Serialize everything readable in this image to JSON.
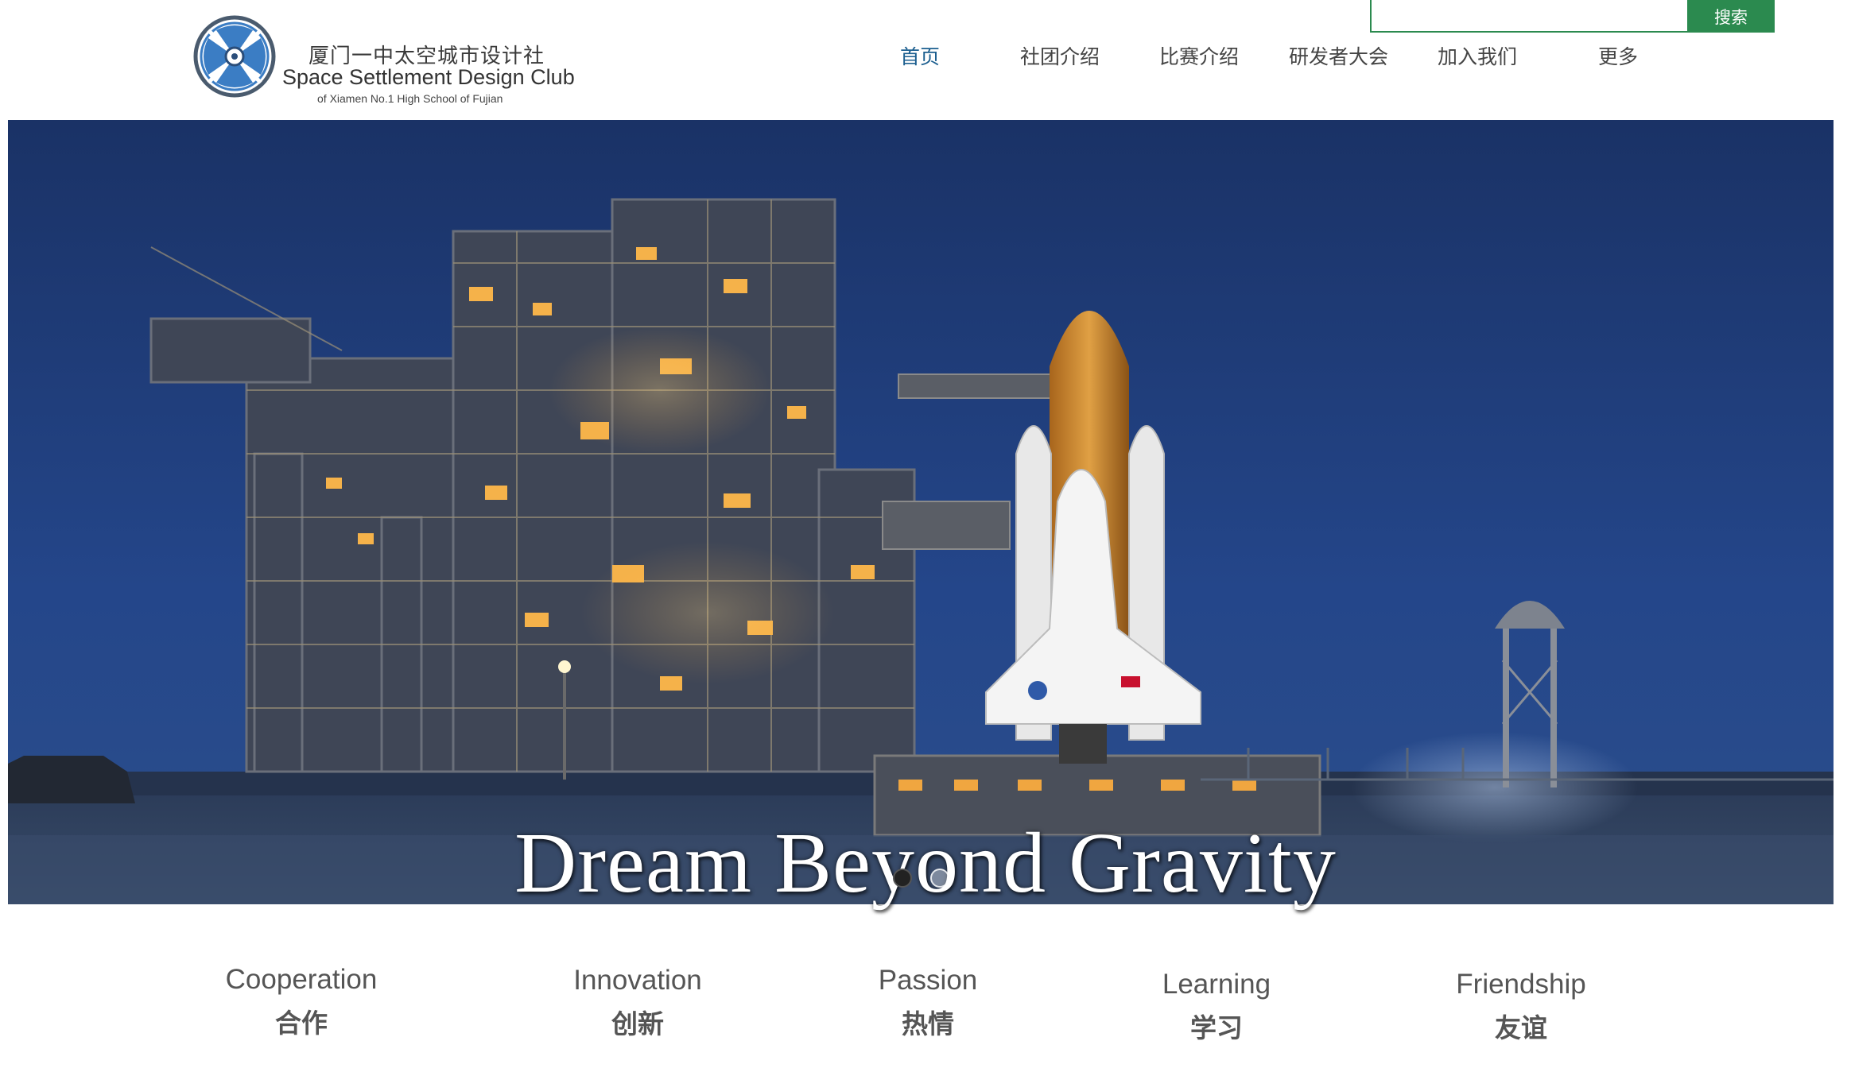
{
  "brand": {
    "name_cn": "厦门一中太空城市设计社",
    "name_en": "Space Settlement Design Club",
    "subtitle": "of Xiamen No.1 High School of Fujian",
    "logo_icon": "fan-circle-logo",
    "accent": "#2b8a4f",
    "nav_active_color": "#1b5e8f"
  },
  "search": {
    "value": "",
    "placeholder": "",
    "button_label": "搜索"
  },
  "nav": {
    "items": [
      {
        "label": "首页",
        "active": true
      },
      {
        "label": "社团介绍",
        "active": false
      },
      {
        "label": "比赛介绍",
        "active": false
      },
      {
        "label": "研发者大会",
        "active": false
      },
      {
        "label": "加入我们",
        "active": false
      },
      {
        "label": "更多",
        "active": false
      }
    ]
  },
  "hero": {
    "caption": "Dream Beyond Gravity",
    "image_subject": "space-shuttle-on-launch-pad",
    "slides_total": 2,
    "active_slide": 1
  },
  "values": [
    {
      "en": "Cooperation",
      "cn": "合作"
    },
    {
      "en": "Innovation",
      "cn": "创新"
    },
    {
      "en": "Passion",
      "cn": "热情"
    },
    {
      "en": "Learning",
      "cn": "学习"
    },
    {
      "en": "Friendship",
      "cn": "友谊"
    }
  ]
}
